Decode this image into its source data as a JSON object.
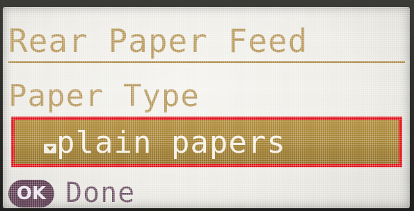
{
  "screen": {
    "title": "Rear Paper Feed",
    "field_label": "Paper Type",
    "selected_value": "plain papers",
    "ok_button_label": "OK",
    "done_label": "Done"
  },
  "colors": {
    "text_accent": "#b89a5e",
    "selection_fill": "#a07e2f",
    "highlight_border": "#e0141b",
    "ok_badge": "#5a3a4e",
    "done_text": "#6e5366"
  },
  "icons": {
    "dropdown": "dropdown-arrow-icon",
    "ok": "ok-button-icon"
  }
}
